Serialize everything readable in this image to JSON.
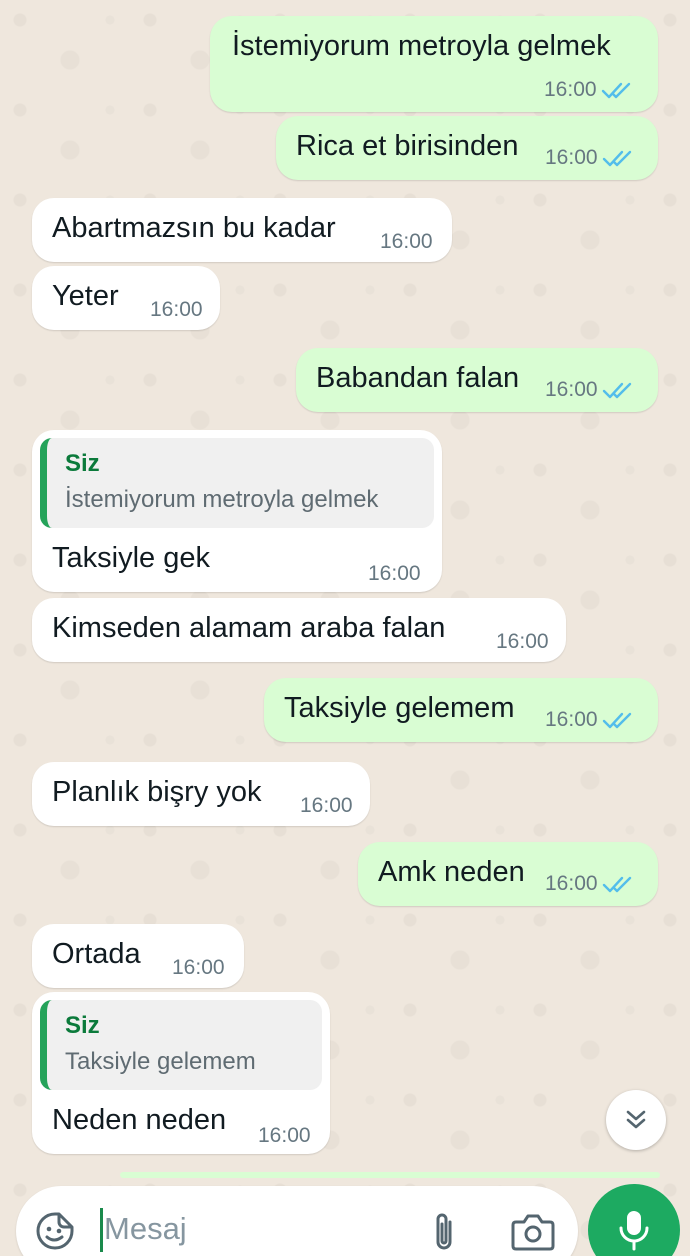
{
  "messages": [
    {
      "text": "İstemiyorum metroyla gelmek",
      "time": "16:00"
    },
    {
      "text": "Rica et birisinden",
      "time": "16:00"
    },
    {
      "text": "Abartmazsın bu kadar",
      "time": "16:00"
    },
    {
      "text": "Yeter",
      "time": "16:00"
    },
    {
      "text": "Babandan falan",
      "time": "16:00"
    },
    {
      "text": "Taksiyle gek",
      "time": "16:00",
      "quote": {
        "author": "Siz",
        "text": "İstemiyorum metroyla gelmek"
      }
    },
    {
      "text": "Kimseden alamam araba falan",
      "time": "16:00"
    },
    {
      "text": "Taksiyle gelemem",
      "time": "16:00"
    },
    {
      "text": "Planlık bişry yok",
      "time": "16:00"
    },
    {
      "text": "Amk neden",
      "time": "16:00"
    },
    {
      "text": "Ortada",
      "time": "16:00"
    },
    {
      "text": "Neden neden",
      "time": "16:00",
      "quote": {
        "author": "Siz",
        "text": "Taksiyle gelemem"
      }
    }
  ],
  "composer": {
    "placeholder": "Mesaj"
  },
  "colors": {
    "outgoing_bubble": "#d9fdd3",
    "incoming_bubble": "#ffffff",
    "read_ticks": "#53bdeb",
    "accent": "#1daa61",
    "quote_bar": "#25a35a"
  },
  "icons": {
    "emoji": "sticker-smile-icon",
    "attach": "paperclip-icon",
    "camera": "camera-icon",
    "mic": "mic-icon",
    "scroll_down": "double-chevron-down-icon",
    "read": "double-check-icon"
  }
}
